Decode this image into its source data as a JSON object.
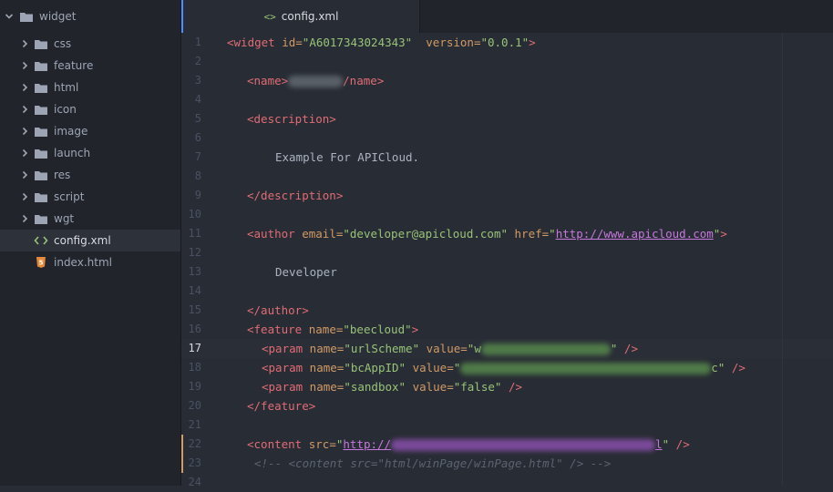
{
  "sidebar": {
    "root": {
      "label": "widget",
      "icon": "folder-icon",
      "expanded": true
    },
    "items": [
      {
        "label": "css",
        "type": "folder"
      },
      {
        "label": "feature",
        "type": "folder"
      },
      {
        "label": "html",
        "type": "folder"
      },
      {
        "label": "icon",
        "type": "folder"
      },
      {
        "label": "image",
        "type": "folder"
      },
      {
        "label": "launch",
        "type": "folder"
      },
      {
        "label": "res",
        "type": "folder"
      },
      {
        "label": "script",
        "type": "folder"
      },
      {
        "label": "wgt",
        "type": "folder"
      },
      {
        "label": "config.xml",
        "type": "file",
        "icon": "code-file-icon",
        "selected": true
      },
      {
        "label": "index.html",
        "type": "file",
        "icon": "html5-file-icon"
      }
    ]
  },
  "tab": {
    "label": "config.xml",
    "icon": "<>"
  },
  "editor": {
    "current_line": 17,
    "line_numbers": [
      "1",
      "2",
      "3",
      "4",
      "5",
      "6",
      "7",
      "8",
      "9",
      "10",
      "11",
      "12",
      "13",
      "14",
      "15",
      "16",
      "17",
      "18",
      "19",
      "20",
      "21",
      "22",
      "23",
      "24"
    ],
    "lines": {
      "l1": {
        "a": "<widget",
        "b": " id=",
        "c": "\"A6017343024343\"",
        "d": "  version=",
        "e": "\"0.0.1\"",
        "f": ">"
      },
      "l3": {
        "a": "<name>",
        "b": "/name>"
      },
      "l5": {
        "a": "<description>"
      },
      "l7": {
        "a": "Example For APICloud."
      },
      "l9": {
        "a": "</description>"
      },
      "l11": {
        "a": "<author",
        "b": " email=",
        "c": "\"developer@apicloud.com\"",
        "d": " href=",
        "e": "\"",
        "f": "http://www.apicloud.com",
        "g": "\"",
        "h": ">"
      },
      "l13": {
        "a": "Developer"
      },
      "l15": {
        "a": "</author>"
      },
      "l16": {
        "a": "<feature",
        "b": " name=",
        "c": "\"beecloud\"",
        "d": ">"
      },
      "l17": {
        "a": "<param",
        "b": " name=",
        "c": "\"urlScheme\"",
        "d": " value=",
        "e": "\"w",
        "f": "\"",
        "g": " />"
      },
      "l18": {
        "a": "<param",
        "b": " name=",
        "c": "\"bcAppID\"",
        "d": " value=",
        "e": "\"",
        "f": "c\"",
        "g": " />"
      },
      "l19": {
        "a": "<param",
        "b": " name=",
        "c": "\"sandbox\"",
        "d": " value=",
        "e": "\"false\"",
        "f": " />"
      },
      "l20": {
        "a": "</feature>"
      },
      "l22": {
        "a": "<content",
        "b": " src=",
        "c": "\"",
        "d": "http://",
        "e": "l",
        "f": "\"",
        "g": " />"
      },
      "l23": {
        "a": "<!-- <content src=\"html/winPage/winPage.html\" /> -->"
      }
    }
  },
  "colors": {
    "background": "#282c34",
    "sidebar": "#21252b",
    "tag": "#e06c75",
    "attribute": "#d19a66",
    "string": "#98c379",
    "link": "#c678dd",
    "comment": "#5c6370",
    "active_tab_border": "#528bff"
  }
}
